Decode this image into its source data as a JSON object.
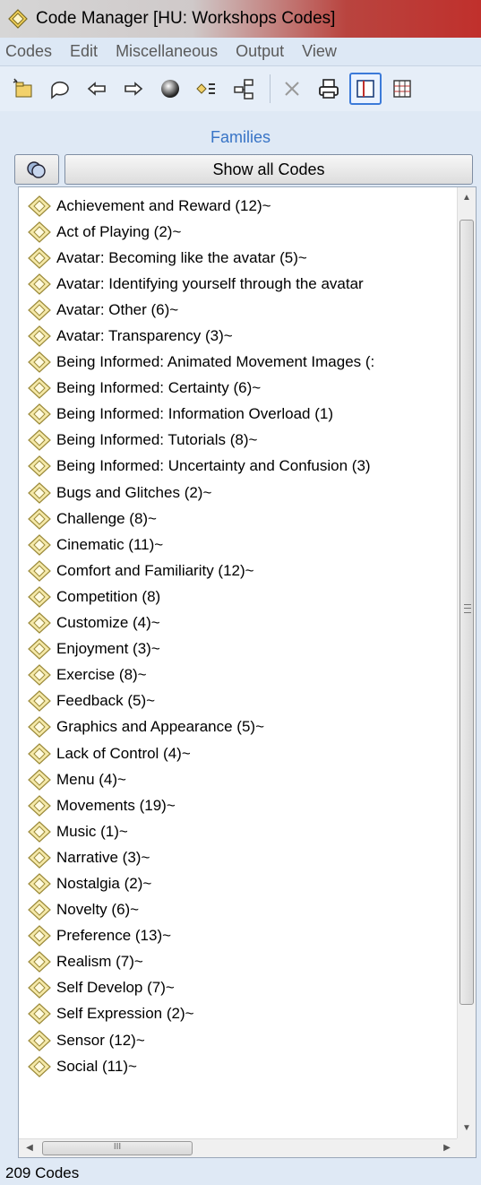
{
  "window": {
    "title": "Code Manager [HU: Workshops Codes]"
  },
  "menu": {
    "items": [
      {
        "label": "Codes"
      },
      {
        "label": "Edit"
      },
      {
        "label": "Miscellaneous"
      },
      {
        "label": "Output"
      },
      {
        "label": "View"
      }
    ]
  },
  "toolbar": {
    "icons": [
      "new-code-icon",
      "comment-icon",
      "back-arrow-icon",
      "forward-arrow-icon",
      "sphere-icon",
      "list-filter-icon",
      "network-icon",
      "delete-icon",
      "print-icon",
      "split-view-icon",
      "grid-view-icon"
    ]
  },
  "families": {
    "header": "Families",
    "show_all_label": "Show all Codes"
  },
  "codes": [
    {
      "label": "Achievement and Reward (12)~"
    },
    {
      "label": "Act of Playing (2)~"
    },
    {
      "label": "Avatar: Becoming like the avatar (5)~"
    },
    {
      "label": "Avatar: Identifying yourself through the avatar"
    },
    {
      "label": "Avatar: Other (6)~"
    },
    {
      "label": "Avatar: Transparency (3)~"
    },
    {
      "label": "Being Informed: Animated Movement Images (:"
    },
    {
      "label": "Being Informed: Certainty (6)~"
    },
    {
      "label": "Being Informed: Information Overload (1)"
    },
    {
      "label": "Being Informed: Tutorials (8)~"
    },
    {
      "label": "Being Informed: Uncertainty and Confusion (3)"
    },
    {
      "label": "Bugs and Glitches (2)~"
    },
    {
      "label": "Challenge (8)~"
    },
    {
      "label": "Cinematic (11)~"
    },
    {
      "label": "Comfort and Familiarity (12)~"
    },
    {
      "label": "Competition (8)"
    },
    {
      "label": "Customize (4)~"
    },
    {
      "label": "Enjoyment (3)~"
    },
    {
      "label": "Exercise (8)~"
    },
    {
      "label": "Feedback (5)~"
    },
    {
      "label": "Graphics and Appearance (5)~"
    },
    {
      "label": "Lack of Control (4)~"
    },
    {
      "label": "Menu (4)~"
    },
    {
      "label": "Movements (19)~"
    },
    {
      "label": "Music (1)~"
    },
    {
      "label": "Narrative (3)~"
    },
    {
      "label": "Nostalgia (2)~"
    },
    {
      "label": "Novelty (6)~"
    },
    {
      "label": "Preference (13)~"
    },
    {
      "label": "Realism (7)~"
    },
    {
      "label": "Self Develop (7)~"
    },
    {
      "label": "Self Expression (2)~"
    },
    {
      "label": "Sensor (12)~"
    },
    {
      "label": "Social (11)~"
    }
  ],
  "hscroll": {
    "thumb_grip": "III"
  },
  "status": {
    "count_text": "209 Codes"
  },
  "colors": {
    "accent": "#3874c6",
    "title_gradient_end": "#c0302c"
  }
}
